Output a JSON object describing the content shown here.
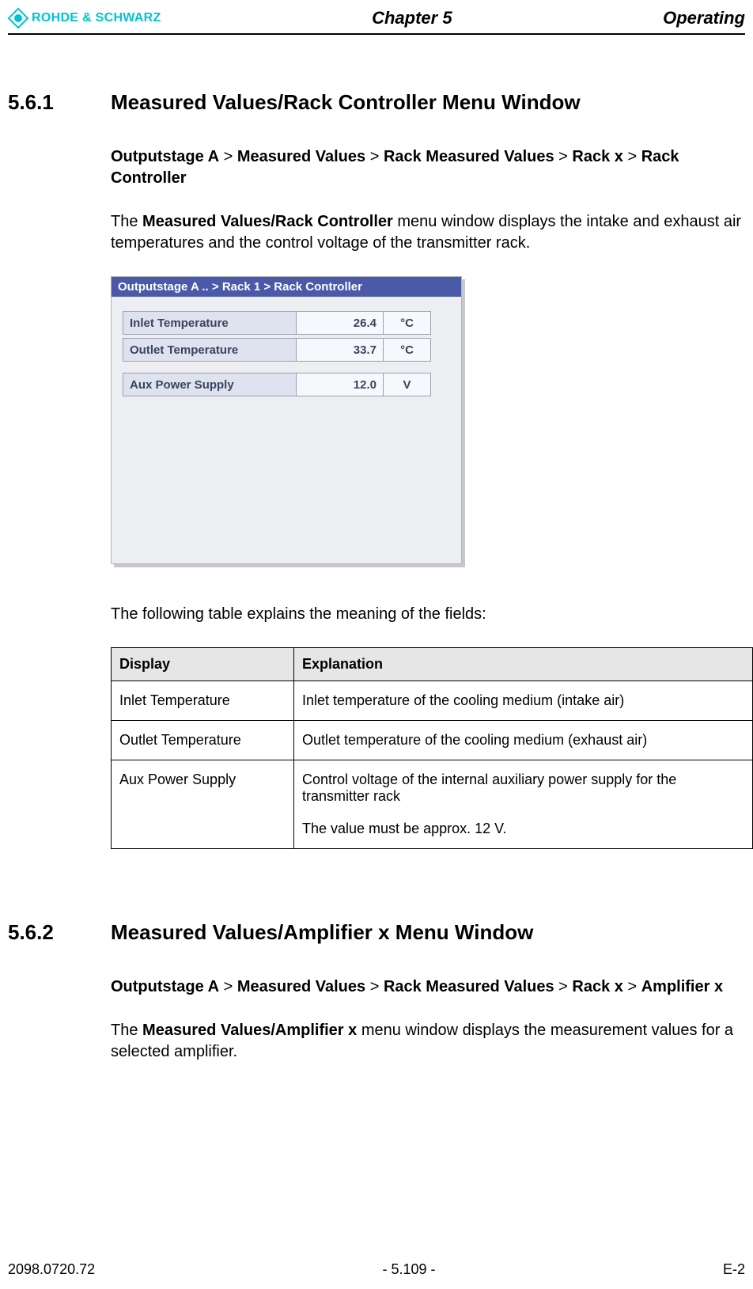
{
  "header": {
    "brand": "ROHDE & SCHWARZ",
    "chapter": "Chapter 5",
    "right": "Operating"
  },
  "section1": {
    "num": "5.6.1",
    "title": "Measured Values/Rack Controller Menu Window",
    "breadcrumb": {
      "p1": "Outputstage A",
      "sep": " > ",
      "p2": "Measured Values",
      "p3": "Rack Measured Values",
      "p4": "Rack x",
      "p5": "Rack Controller"
    },
    "intro_pre": "The ",
    "intro_bold": "Measured Values/Rack Controller",
    "intro_post": " menu window displays the intake and exhaust air temperatures and the control voltage of the transmitter rack.",
    "panel": {
      "title": "Outputstage A .. > Rack 1 > Rack Controller",
      "rows": [
        {
          "label": "Inlet Temperature",
          "value": "26.4",
          "unit": "°C"
        },
        {
          "label": "Outlet Temperature",
          "value": "33.7",
          "unit": "°C"
        },
        {
          "label": "Aux Power Supply",
          "value": "12.0",
          "unit": "V"
        }
      ]
    },
    "table_intro": "The following table explains the meaning of the fields:",
    "table": {
      "head_display": "Display",
      "head_explanation": "Explanation",
      "rows": [
        {
          "display": "Inlet Temperature",
          "explanation": "Inlet temperature of the cooling medium (intake air)"
        },
        {
          "display": "Outlet Temperature",
          "explanation": "Outlet temperature of the cooling medium (exhaust air)"
        },
        {
          "display": "Aux Power Supply",
          "explanation_line1": "Control voltage of the internal auxiliary power supply for the transmitter rack",
          "explanation_line2": "The value must be approx. 12 V."
        }
      ]
    }
  },
  "section2": {
    "num": "5.6.2",
    "title": "Measured Values/Amplifier x Menu Window",
    "breadcrumb": {
      "p1": "Outputstage A",
      "sep": " > ",
      "p2": "Measured Values",
      "p3": "Rack Measured Values",
      "p4": "Rack x",
      "p5": "Amplifier x"
    },
    "intro_pre": "The ",
    "intro_bold": "Measured Values/Amplifier x",
    "intro_post": " menu window displays the measurement values for a selected amplifier."
  },
  "footer": {
    "left": "2098.0720.72",
    "center": "- 5.109 -",
    "right": "E-2"
  }
}
